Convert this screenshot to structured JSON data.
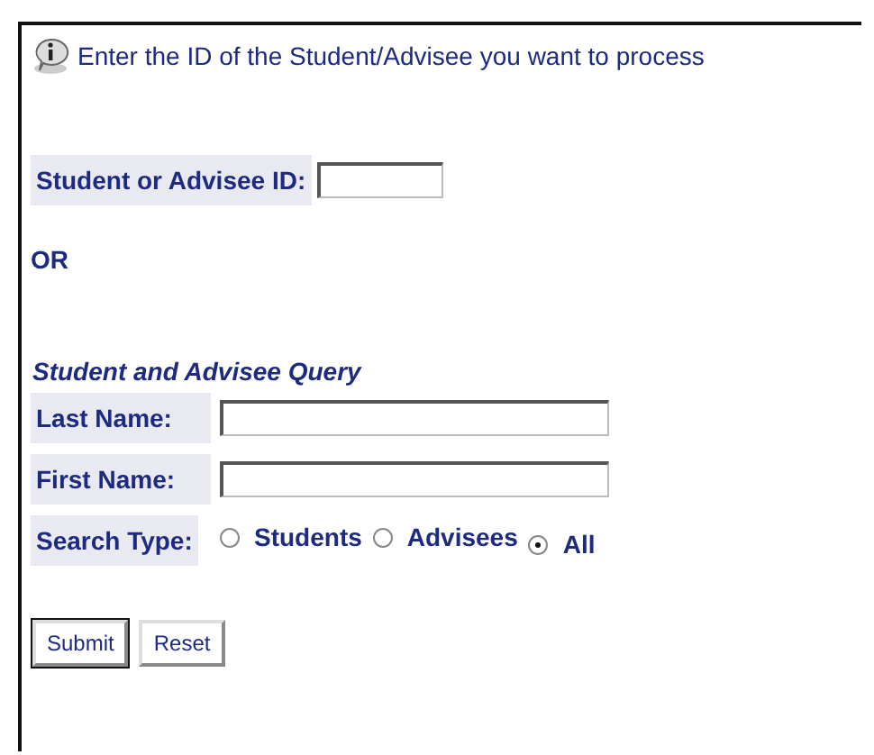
{
  "info": {
    "text": "Enter the ID of the Student/Advisee you want to process"
  },
  "id_field": {
    "label": "Student or Advisee ID:"
  },
  "separator": "OR",
  "query": {
    "title": "Student and Advisee Query",
    "fields": [
      {
        "label": "Last Name:"
      },
      {
        "label": "First Name:"
      }
    ],
    "search_type": {
      "label": "Search Type:",
      "options": [
        {
          "label": "Students",
          "selected": false
        },
        {
          "label": "Advisees",
          "selected": false
        },
        {
          "label": "All",
          "selected": true
        }
      ]
    }
  },
  "buttons": [
    {
      "label": "Submit",
      "default": true
    },
    {
      "label": "Reset",
      "default": false
    }
  ]
}
